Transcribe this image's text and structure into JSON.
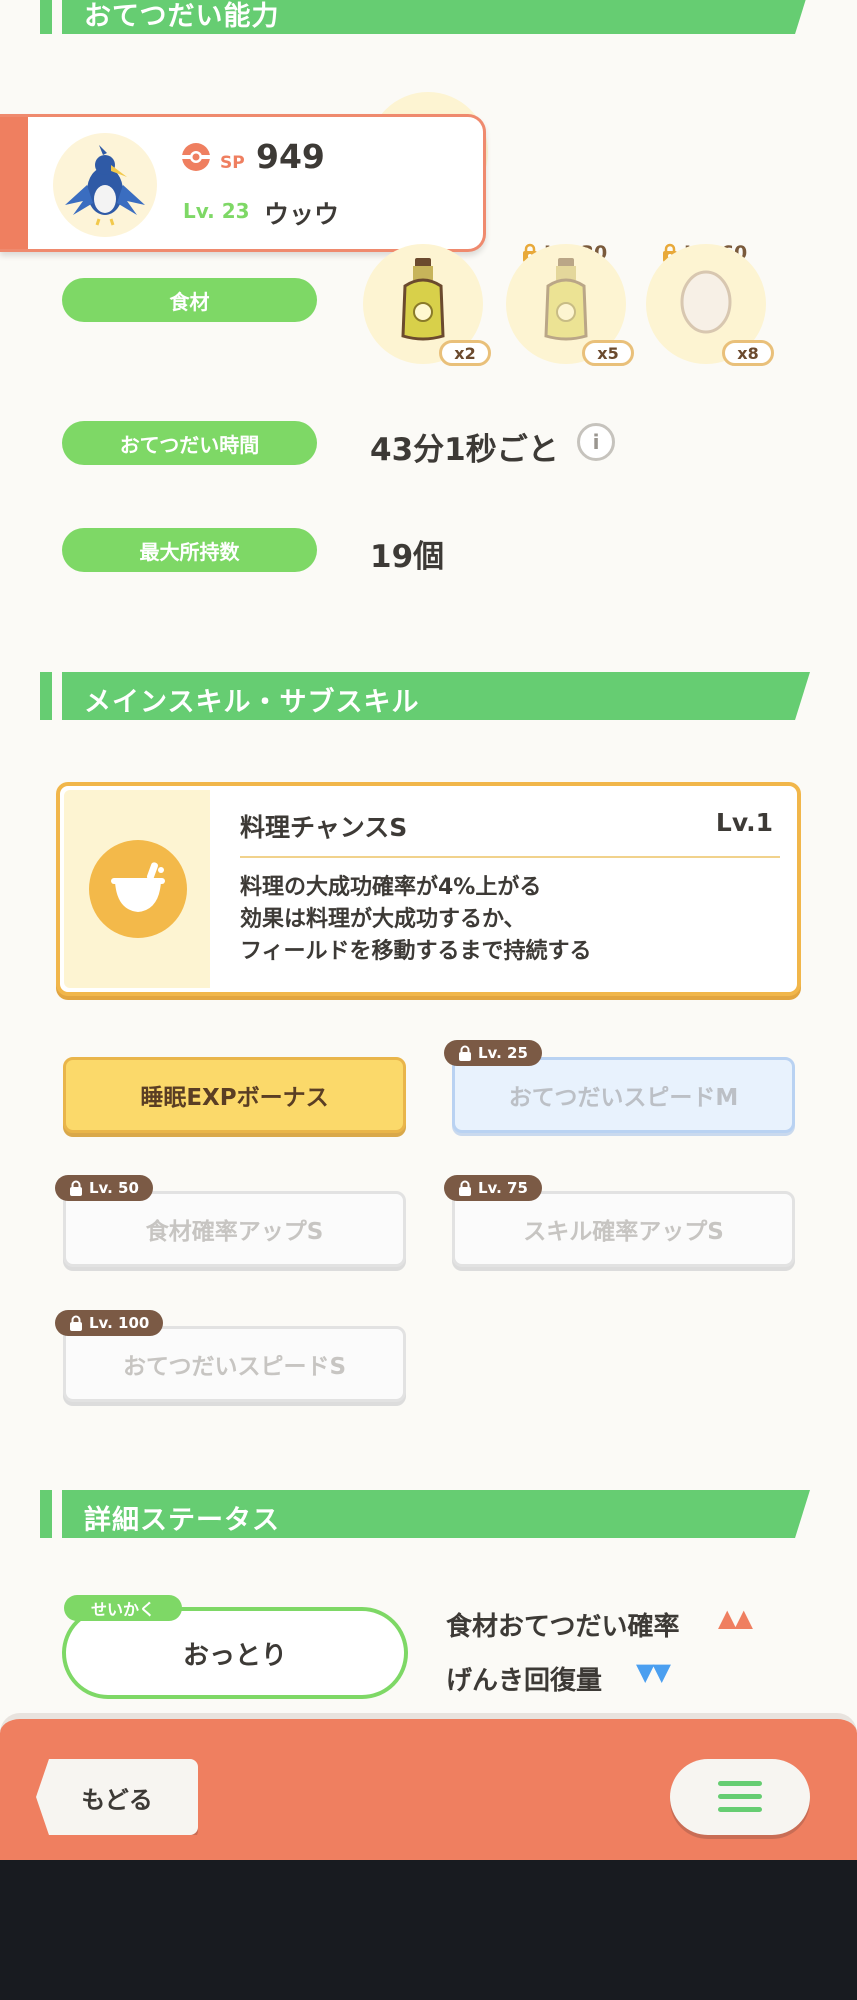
{
  "sections": {
    "help_ability": "おてつだい能力",
    "skills": "メインスキル・サブスキル",
    "details": "詳細ステータス"
  },
  "pokemon": {
    "sp_label": "SP",
    "sp_value": "949",
    "level": "Lv. 23",
    "name": "ウッウ"
  },
  "help": {
    "ingredients_label": "食材",
    "ingredients": [
      {
        "count": "x2",
        "unlock": ""
      },
      {
        "count": "x5",
        "unlock": "Lv. 30"
      },
      {
        "count": "x8",
        "unlock": "Lv. 60"
      }
    ],
    "time_label": "おてつだい時間",
    "time_value": "43分1秒ごと",
    "max_label": "最大所持数",
    "max_value": "19個"
  },
  "main_skill": {
    "name": "料理チャンスS",
    "level": "Lv.1",
    "desc_lines": [
      "料理の大成功確率が4%上がる",
      "効果は料理が大成功するか、",
      "フィールドを移動するまで持続する"
    ]
  },
  "sub_skills": [
    {
      "label": "睡眠EXPボーナス",
      "unlock": ""
    },
    {
      "label": "おてつだいスピードM",
      "unlock": "Lv. 25"
    },
    {
      "label": "食材確率アップS",
      "unlock": "Lv. 50"
    },
    {
      "label": "スキル確率アップS",
      "unlock": "Lv. 75"
    },
    {
      "label": "おてつだいスピードS",
      "unlock": "Lv. 100"
    }
  ],
  "nature": {
    "tag": "せいかく",
    "name": "おっとり",
    "up_label": "食材おてつだい確率",
    "up_marks": "▲▲",
    "down_label": "げんき回復量",
    "down_marks": "▼▼"
  },
  "nav": {
    "back_label": "もどる"
  },
  "colors": {
    "accent_green": "#66cd72",
    "accent_orange": "#ef7f60",
    "gold": "#f1b64a",
    "up_color": "#ef7f60",
    "down_color": "#4b9ff0"
  }
}
